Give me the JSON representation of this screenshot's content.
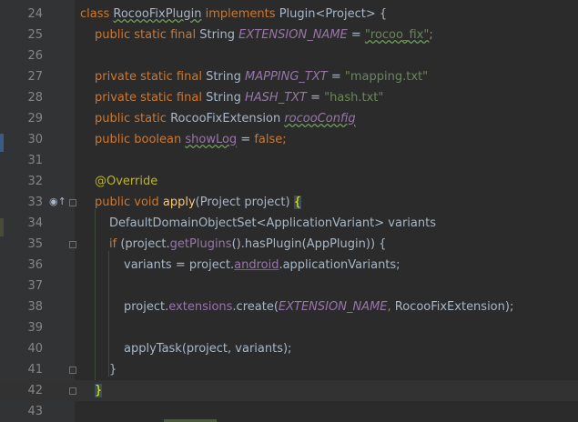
{
  "lines": [
    {
      "num": "24",
      "tokens": [
        [
          "kw",
          "class "
        ],
        [
          "typ squiggle",
          "RocooFixPlugin"
        ],
        [
          "kw",
          " implements "
        ],
        [
          "typ",
          "Plugin"
        ],
        [
          "typ",
          "<Project> {"
        ]
      ]
    },
    {
      "num": "25",
      "tokens": [
        [
          "kw",
          "public static final "
        ],
        [
          "typ",
          "String "
        ],
        [
          "const",
          "EXTENSION_NAME"
        ],
        [
          "typ",
          " = "
        ],
        [
          "str squiggle",
          "\"rocoo_fix\""
        ],
        [
          "kw",
          ";"
        ]
      ]
    },
    {
      "num": "26",
      "tokens": []
    },
    {
      "num": "27",
      "tokens": [
        [
          "kw",
          "private static final "
        ],
        [
          "typ",
          "String "
        ],
        [
          "const",
          "MAPPING_TXT"
        ],
        [
          "typ",
          " = "
        ],
        [
          "str",
          "\"mapping.txt\""
        ]
      ]
    },
    {
      "num": "28",
      "tokens": [
        [
          "kw",
          "private static final "
        ],
        [
          "typ",
          "String "
        ],
        [
          "const",
          "HASH_TXT"
        ],
        [
          "typ",
          " = "
        ],
        [
          "str",
          "\"hash.txt\""
        ]
      ]
    },
    {
      "num": "29",
      "tokens": [
        [
          "kw",
          "public static "
        ],
        [
          "typ",
          "RocooFixExtension "
        ],
        [
          "const squiggle",
          "rocooConfig"
        ]
      ]
    },
    {
      "num": "30",
      "tokens": [
        [
          "kw",
          "public boolean "
        ],
        [
          "field squiggle",
          "showLog"
        ],
        [
          "typ",
          " = "
        ],
        [
          "kw",
          "false;"
        ]
      ]
    },
    {
      "num": "31",
      "tokens": []
    },
    {
      "num": "32",
      "tokens": [
        [
          "ann",
          "@Override"
        ]
      ]
    },
    {
      "num": "33",
      "tokens": [
        [
          "kw",
          "public void "
        ],
        [
          "fn",
          "apply"
        ],
        [
          "typ",
          "(Project project) "
        ],
        [
          "brace-hl",
          "{"
        ]
      ]
    },
    {
      "num": "34",
      "tokens": [
        [
          "typ",
          "DefaultDomainObjectSet<ApplicationVariant> variants"
        ]
      ]
    },
    {
      "num": "35",
      "tokens": [
        [
          "kw",
          "if "
        ],
        [
          "typ",
          "(project."
        ],
        [
          "field",
          "getPlugins"
        ],
        [
          "typ",
          "().hasPlugin(AppPlugin)) {"
        ]
      ]
    },
    {
      "num": "36",
      "tokens": [
        [
          "typ",
          "variants = project."
        ],
        [
          "muted",
          "android"
        ],
        [
          "typ",
          ".applicationVariants;"
        ]
      ]
    },
    {
      "num": "37",
      "tokens": []
    },
    {
      "num": "38",
      "tokens": [
        [
          "typ",
          "project."
        ],
        [
          "field",
          "extensions"
        ],
        [
          "typ",
          ".create("
        ],
        [
          "const",
          "EXTENSION_NAME"
        ],
        [
          "kw",
          ", "
        ],
        [
          "typ",
          "RocooFixExtension);"
        ]
      ]
    },
    {
      "num": "39",
      "tokens": []
    },
    {
      "num": "40",
      "tokens": [
        [
          "typ",
          "applyTask(project, variants);"
        ]
      ]
    },
    {
      "num": "41",
      "tokens": [
        [
          "typ",
          "}"
        ]
      ]
    },
    {
      "num": "42",
      "tokens": [
        [
          "brace-hl",
          "}"
        ]
      ]
    },
    {
      "num": "43",
      "tokens": []
    }
  ],
  "icons": {
    "override_marker": "override-gutter-icon"
  }
}
